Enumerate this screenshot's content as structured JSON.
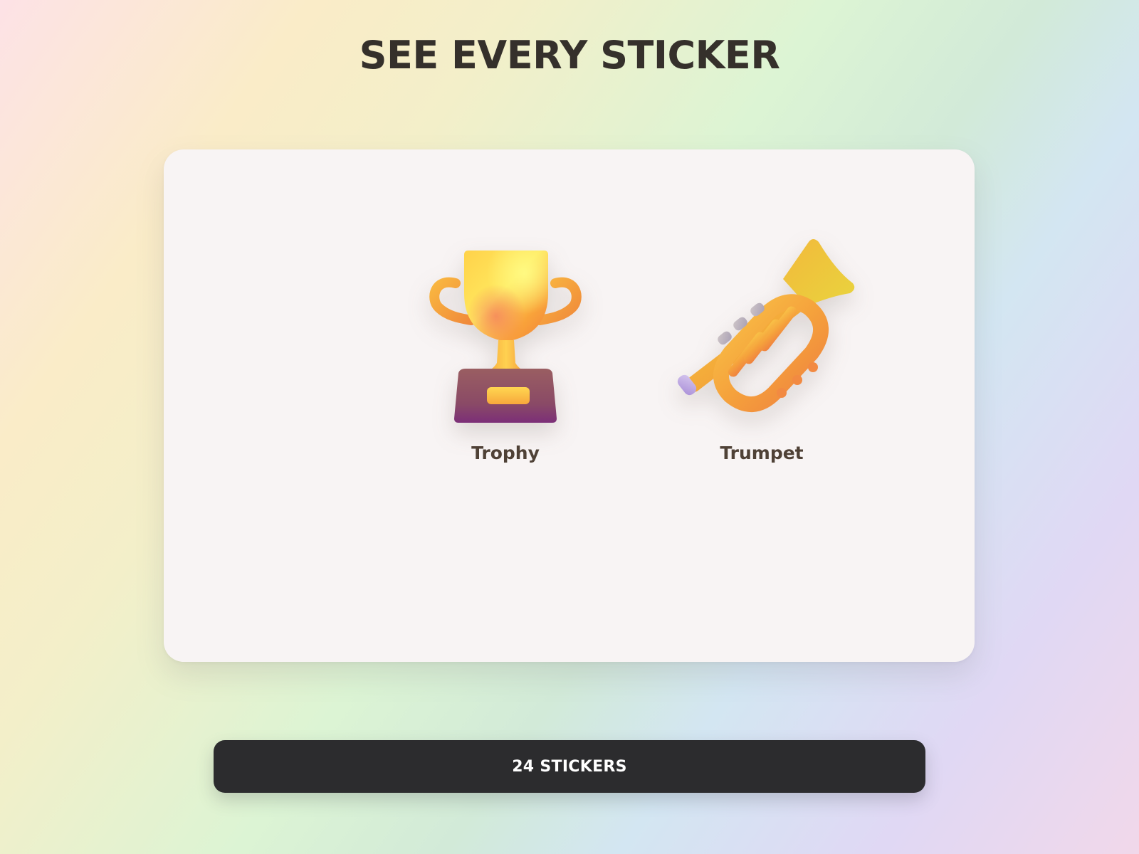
{
  "header": {
    "title": "SEE EVERY STICKER"
  },
  "stickers": [
    {
      "label": "Trophy",
      "icon": "trophy-icon"
    },
    {
      "label": "Trumpet",
      "icon": "trumpet-icon"
    }
  ],
  "footer": {
    "count_label": "24 STICKERS"
  },
  "colors": {
    "title": "#35302b",
    "card": "#f8f4f4",
    "label": "#4f4136",
    "bar": "#2c2c2e",
    "bar_text": "#ffffff",
    "gold": "#f7b733",
    "base": "#8a4a6a"
  }
}
